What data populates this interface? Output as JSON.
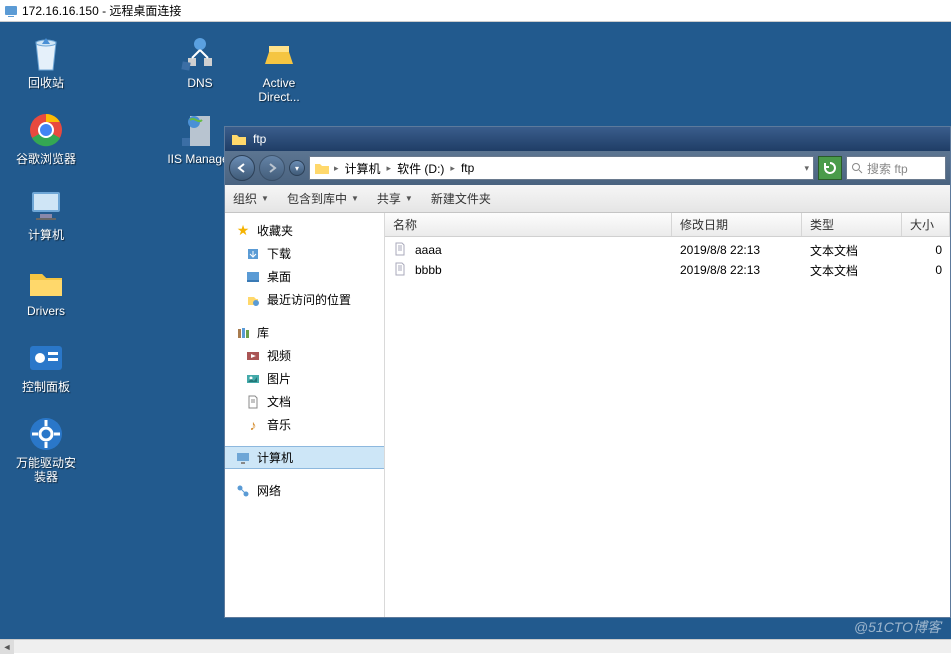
{
  "rdp": {
    "title": "172.16.16.150 - 远程桌面连接"
  },
  "desktop": {
    "col1": [
      {
        "name": "recycle-bin",
        "label": "回收站"
      },
      {
        "name": "chrome",
        "label": "谷歌浏览器"
      },
      {
        "name": "computer",
        "label": "计算机"
      },
      {
        "name": "drivers",
        "label": "Drivers"
      },
      {
        "name": "control-panel",
        "label": "控制面板"
      },
      {
        "name": "driver-installer",
        "label": "万能驱动安装器"
      }
    ],
    "col2": [
      {
        "name": "dns",
        "label": "DNS"
      },
      {
        "name": "iis",
        "label": "IIS Manager"
      }
    ],
    "col3": [
      {
        "name": "active-dir",
        "label": "Active Direct..."
      }
    ]
  },
  "explorer": {
    "title": "ftp",
    "breadcrumb": [
      "计算机",
      "软件 (D:)",
      "ftp"
    ],
    "search_placeholder": "搜索 ftp",
    "toolbar": {
      "organize": "组织",
      "include": "包含到库中",
      "share": "共享",
      "newfolder": "新建文件夹"
    },
    "sidebar": {
      "favorites": {
        "header": "收藏夹",
        "items": [
          "下载",
          "桌面",
          "最近访问的位置"
        ]
      },
      "libraries": {
        "header": "库",
        "items": [
          "视频",
          "图片",
          "文档",
          "音乐"
        ]
      },
      "computer": {
        "header": "计算机"
      },
      "network": {
        "header": "网络"
      }
    },
    "columns": {
      "name": "名称",
      "date": "修改日期",
      "type": "类型",
      "size": "大小"
    },
    "files": [
      {
        "name": "aaaa",
        "date": "2019/8/8 22:13",
        "type": "文本文档",
        "size": "0"
      },
      {
        "name": "bbbb",
        "date": "2019/8/8 22:13",
        "type": "文本文档",
        "size": "0"
      }
    ]
  },
  "watermark": "@51CTO博客"
}
